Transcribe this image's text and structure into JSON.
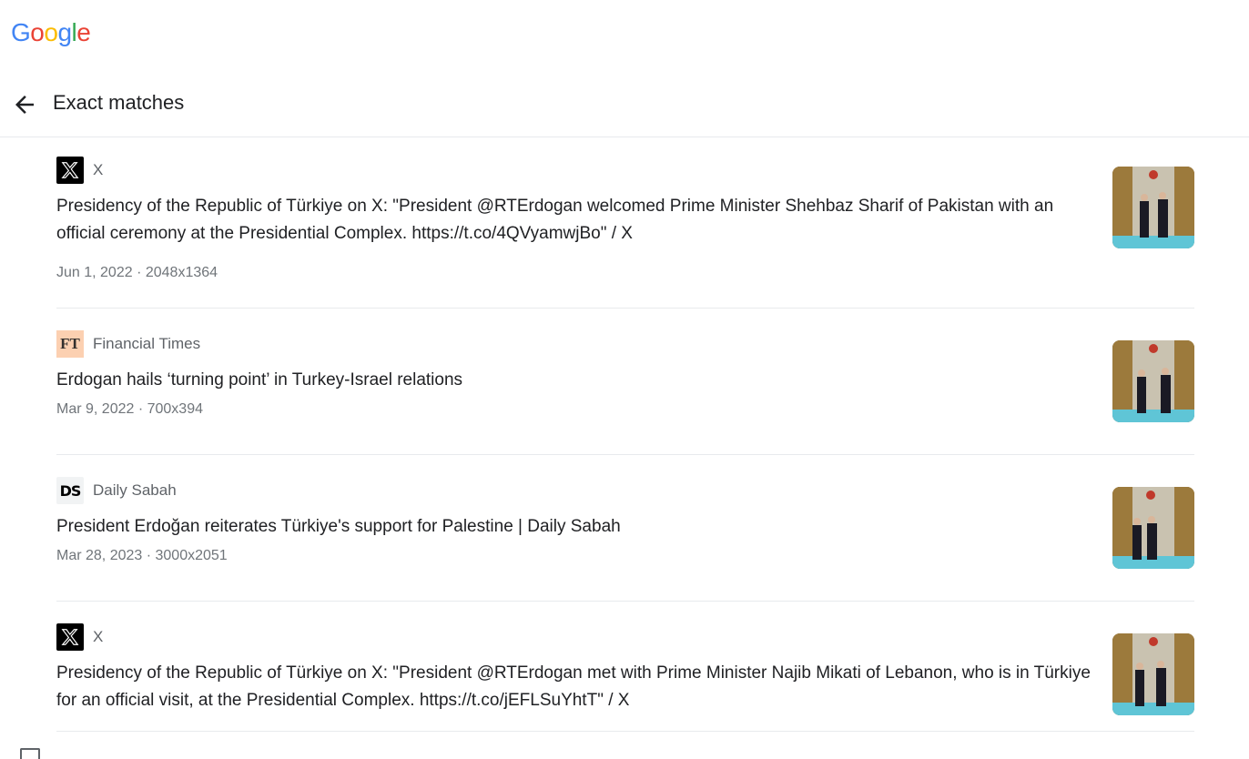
{
  "logo": {
    "text": "Google",
    "letters": [
      "G",
      "o",
      "o",
      "g",
      "l",
      "e"
    ],
    "colors": [
      "#4285F4",
      "#EA4335",
      "#FBBC05",
      "#4285F4",
      "#34A853",
      "#EA4335"
    ]
  },
  "header": {
    "title": "Exact matches",
    "back_icon": "arrow-left-icon"
  },
  "results": [
    {
      "source_icon": "x-logo-icon",
      "source": "X",
      "title": "Presidency of the Republic of Türkiye on X: \"President @RTErdogan welcomed Prime Minister Shehbaz Sharif of Pakistan with an official ceremony at the Presidential Complex. https://t.co/4QVyamwjBo\" / X",
      "meta": "Jun 1, 2022 · 2048x1364"
    },
    {
      "source_icon": "ft-logo-icon",
      "source_logo_text": "FT",
      "source": "Financial Times",
      "title": "Erdogan hails ‘turning point’ in Turkey-Israel relations",
      "meta": "Mar 9, 2022 · 700x394"
    },
    {
      "source_icon": "ds-logo-icon",
      "source_logo_text": "DS",
      "source": "Daily Sabah",
      "title": "President Erdoğan reiterates Türkiye's support for Palestine | Daily Sabah",
      "meta": "Mar 28, 2023 · 3000x2051"
    },
    {
      "source_icon": "x-logo-icon",
      "source": "X",
      "title": "Presidency of the Republic of Türkiye on X: \"President @RTErdogan met with Prime Minister Najib Mikati of Lebanon, who is in Türkiye for an official visit, at the Presidential Complex. https://t.co/jEFLSuYhtT\" / X",
      "meta": ""
    }
  ]
}
